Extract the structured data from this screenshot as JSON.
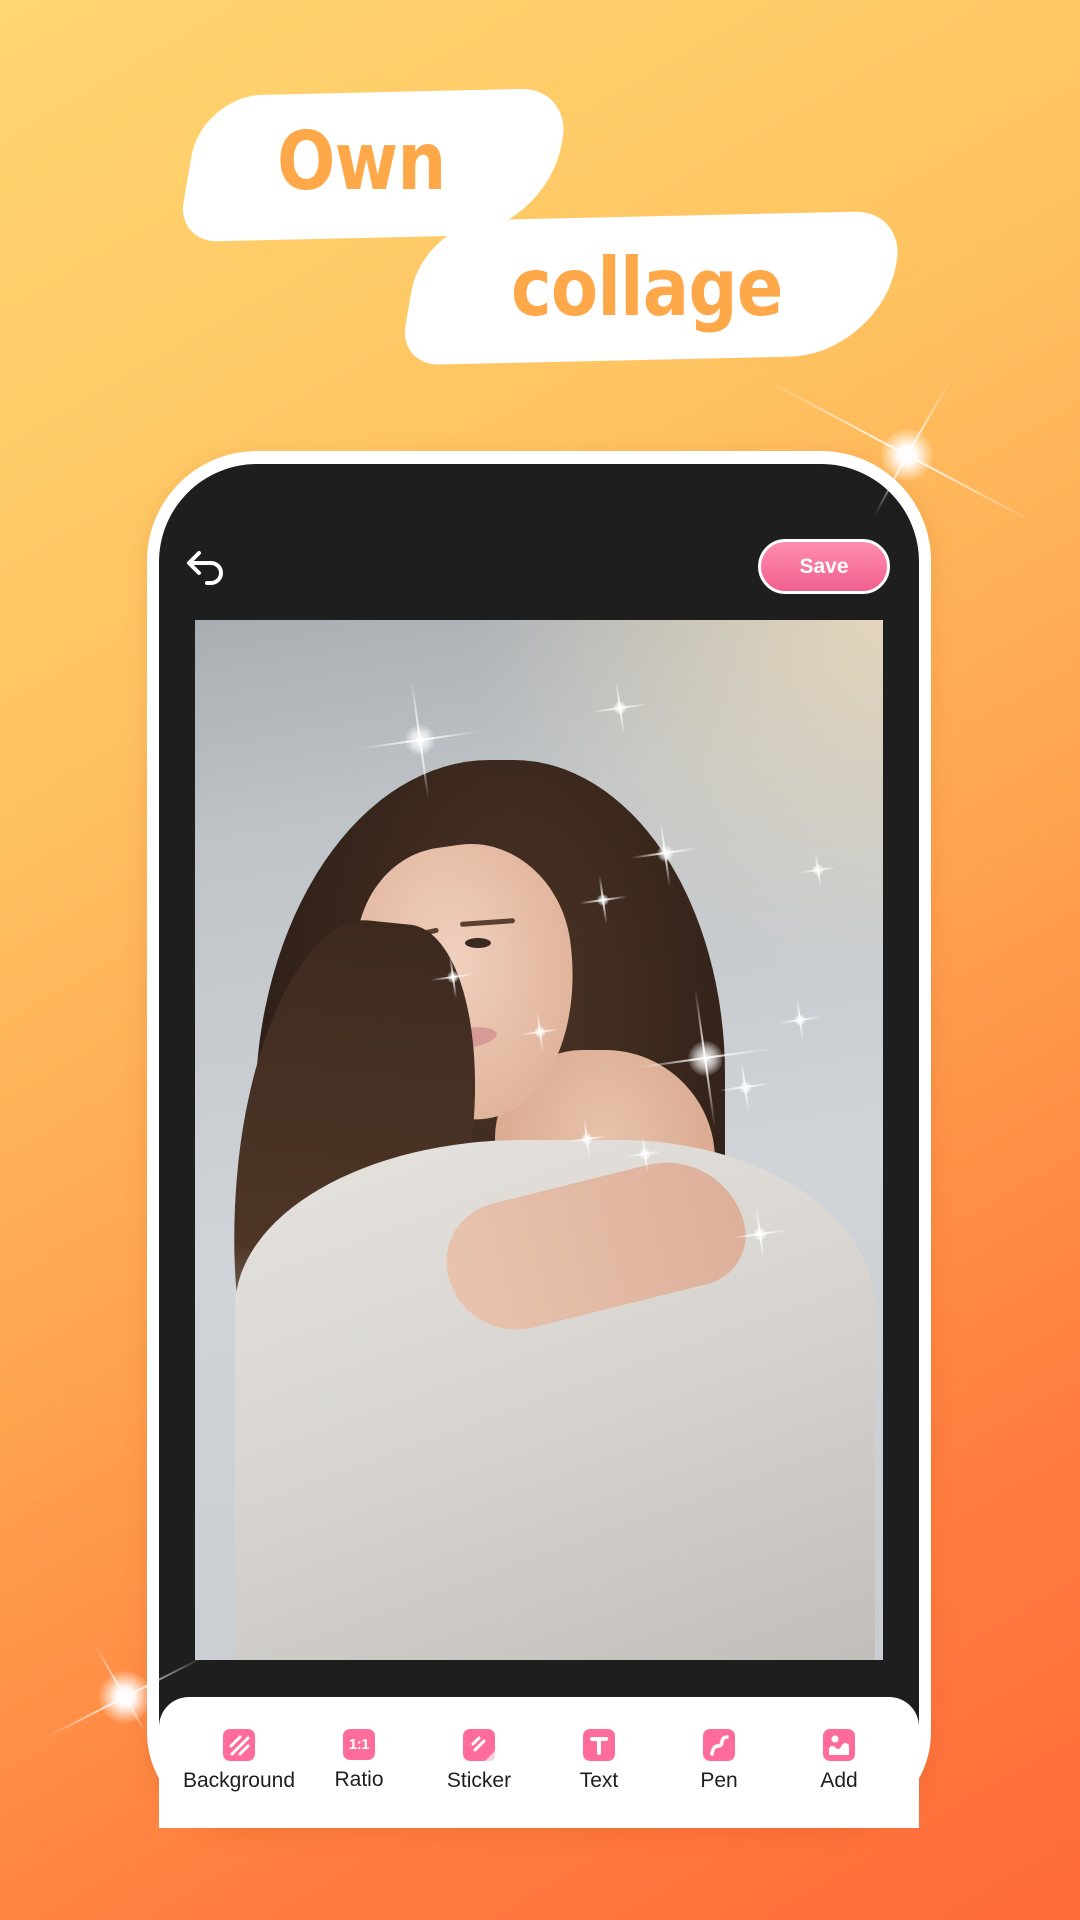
{
  "headline": {
    "line1": "Own",
    "line2": "collage"
  },
  "editor": {
    "undo_icon": "undo-arrow-icon",
    "save_label": "Save"
  },
  "toolbar": {
    "items": [
      {
        "label": "Background",
        "icon": "background-stripes-icon"
      },
      {
        "label": "Ratio",
        "icon": "ratio-icon",
        "icon_text": "1:1"
      },
      {
        "label": "Sticker",
        "icon": "sticker-icon"
      },
      {
        "label": "Text",
        "icon": "text-t-icon",
        "icon_text": "T"
      },
      {
        "label": "Pen",
        "icon": "pen-squiggle-icon"
      },
      {
        "label": "Add",
        "icon": "add-image-icon"
      }
    ]
  },
  "colors": {
    "accent_pink": "#FF6B9A",
    "headline_orange": "#FFA84A",
    "background_top": "#FFD670",
    "background_bottom": "#FF6A3A",
    "screen_dark": "#1E1E1E"
  }
}
